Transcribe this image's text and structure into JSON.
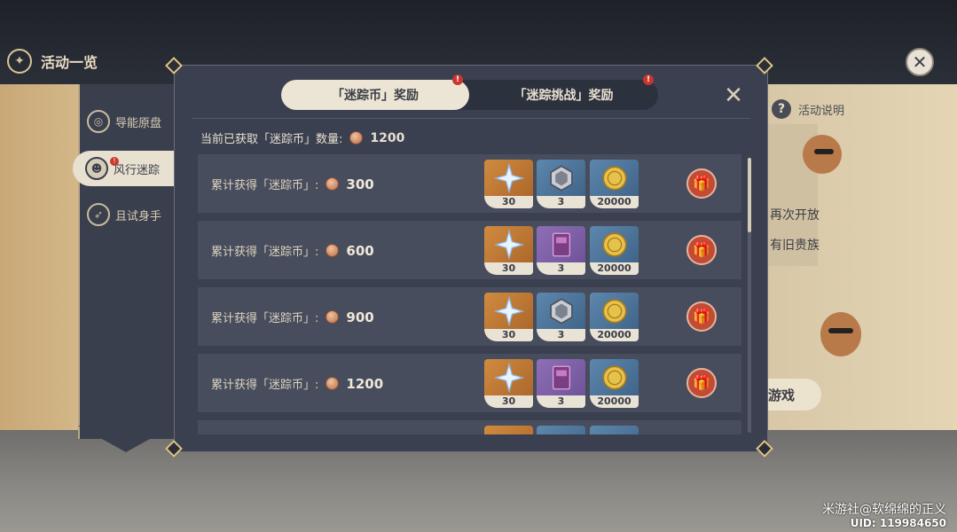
{
  "header": {
    "title": "活动一览"
  },
  "sidebar": {
    "items": [
      {
        "label": "导能原盘",
        "icon": "compass-icon"
      },
      {
        "label": "风行迷踪",
        "icon": "mask-icon",
        "active": true,
        "alert": "!"
      },
      {
        "label": "且试身手",
        "icon": "bow-icon"
      }
    ]
  },
  "modal": {
    "tabs": [
      {
        "label": "「迷踪币」奖励",
        "active": true,
        "badge": "!"
      },
      {
        "label": "「迷踪挑战」奖励",
        "active": false,
        "badge": "!"
      }
    ],
    "summary_label": "当前已获取「迷踪币」数量:",
    "summary_value": "1200",
    "rows": [
      {
        "label": "累计获得「迷踪币」:",
        "value": "300",
        "items": [
          {
            "name": "primogem",
            "qty": "30"
          },
          {
            "name": "mystic-enhancement-ore",
            "qty": "3"
          },
          {
            "name": "mora",
            "qty": "20000"
          }
        ]
      },
      {
        "label": "累计获得「迷踪币」:",
        "value": "600",
        "items": [
          {
            "name": "primogem",
            "qty": "30"
          },
          {
            "name": "heros-wit",
            "qty": "3"
          },
          {
            "name": "mora",
            "qty": "20000"
          }
        ]
      },
      {
        "label": "累计获得「迷踪币」:",
        "value": "900",
        "items": [
          {
            "name": "primogem",
            "qty": "30"
          },
          {
            "name": "mystic-enhancement-ore",
            "qty": "3"
          },
          {
            "name": "mora",
            "qty": "20000"
          }
        ]
      },
      {
        "label": "累计获得「迷踪币」:",
        "value": "1200",
        "items": [
          {
            "name": "primogem",
            "qty": "30"
          },
          {
            "name": "heros-wit",
            "qty": "3"
          },
          {
            "name": "mora",
            "qty": "20000"
          }
        ]
      }
    ]
  },
  "right_panel": {
    "help_label": "活动说明",
    "text1": "再次开放",
    "text2": "有旧贵族",
    "play_label": "游戏"
  },
  "watermark": {
    "line1": "米游社@软绵绵的正义",
    "line2": "UID: 119984650"
  },
  "colors": {
    "accent": "#e0c483",
    "modal_bg": "#3b4050",
    "row_bg": "#474d5d",
    "gift": "#c24b36",
    "badge": "#c8362c"
  }
}
